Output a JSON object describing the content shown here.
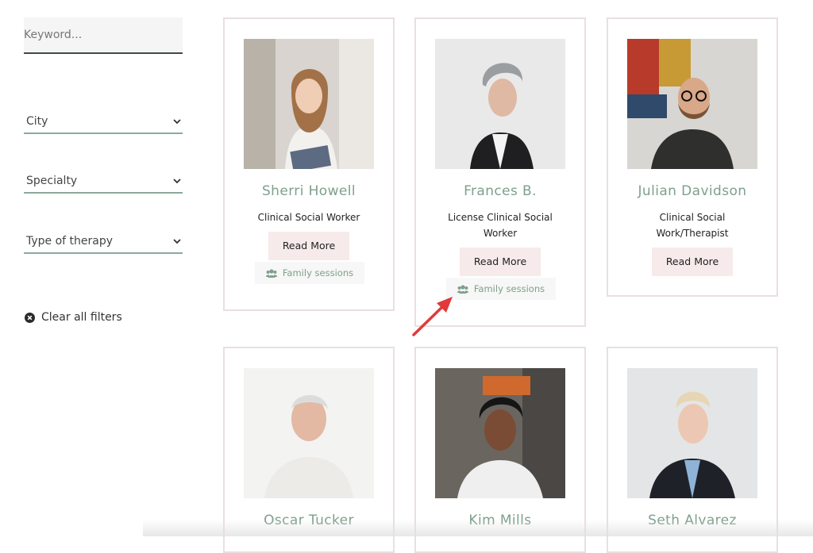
{
  "search": {
    "placeholder": "Keyword..."
  },
  "filters": {
    "city": "City",
    "specialty": "Specialty",
    "therapy": "Type of therapy",
    "clear_label": "Clear all filters"
  },
  "therapists": [
    {
      "name": "Sherri Howell",
      "role": "Clinical Social Worker",
      "read_more": "Read More",
      "tag": "Family sessions"
    },
    {
      "name": "Frances B.",
      "role": "License Clinical Social Worker",
      "read_more": "Read More",
      "tag": "Family sessions"
    },
    {
      "name": "Julian Davidson",
      "role": "Clinical Social Work/Therapist",
      "read_more": "Read More"
    },
    {
      "name": "Oscar Tucker"
    },
    {
      "name": "Kim Mills"
    },
    {
      "name": "Seth Alvarez"
    }
  ],
  "colors": {
    "accent": "#7ea08d",
    "button_bg": "#f6ebea",
    "card_border": "#eadfe0",
    "annotation_arrow": "#e03a3a"
  }
}
